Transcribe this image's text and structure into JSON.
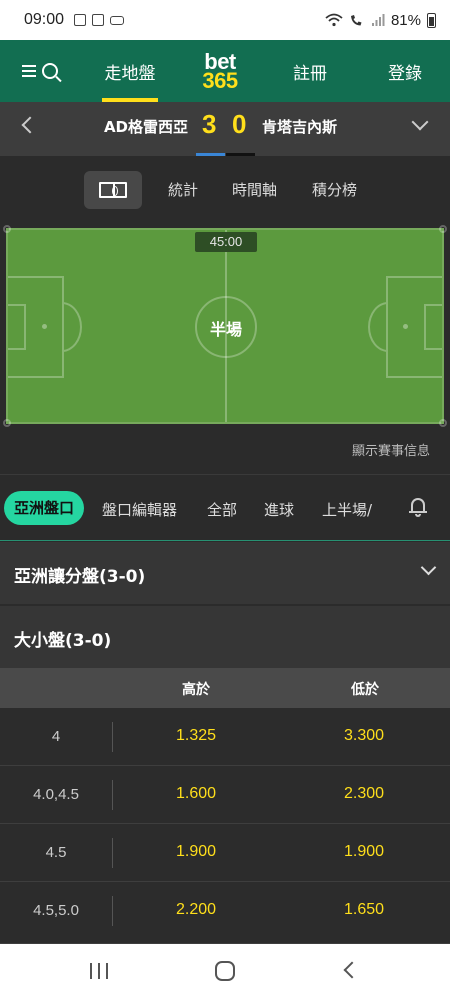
{
  "status_bar": {
    "time": "09:00",
    "battery": "81%",
    "icons": [
      "notification-icon",
      "gallery-icon",
      "voicemail-icon",
      "wifi-icon",
      "wifi-call-icon",
      "signal-icon",
      "battery-icon"
    ]
  },
  "top_nav": {
    "live": "走地盤",
    "logo_top": "bet",
    "logo_bottom": "365",
    "register": "註冊",
    "login": "登錄"
  },
  "match": {
    "home_team": "AD格雷西亞",
    "home_score": "3",
    "away_score": "0",
    "away_team": "肯塔吉內斯"
  },
  "view_tabs": {
    "stats": "統計",
    "timeline": "時間軸",
    "standings": "積分榜"
  },
  "pitch": {
    "clock": "45:00",
    "status": "半場"
  },
  "show_info": "顯示賽事信息",
  "market_tabs": {
    "asian": "亞洲盤口",
    "builder": "盤口編輯器",
    "all": "全部",
    "goals": "進球",
    "first_half": "上半場/"
  },
  "sections": {
    "asian_handicap": "亞洲讓分盤(3-0)",
    "over_under": "大小盤(3-0)"
  },
  "table": {
    "header_over": "高於",
    "header_under": "低於",
    "rows": [
      {
        "line": "4",
        "over": "1.325",
        "under": "3.300"
      },
      {
        "line": "4.0,4.5",
        "over": "1.600",
        "under": "2.300"
      },
      {
        "line": "4.5",
        "over": "1.900",
        "under": "1.900"
      },
      {
        "line": "4.5,5.0",
        "over": "2.200",
        "under": "1.650"
      }
    ]
  },
  "colors": {
    "brand_green": "#126e51",
    "accent_yellow": "#ffdf1b",
    "pill_green": "#25d6a1",
    "pitch_green": "#5c9a3e"
  }
}
